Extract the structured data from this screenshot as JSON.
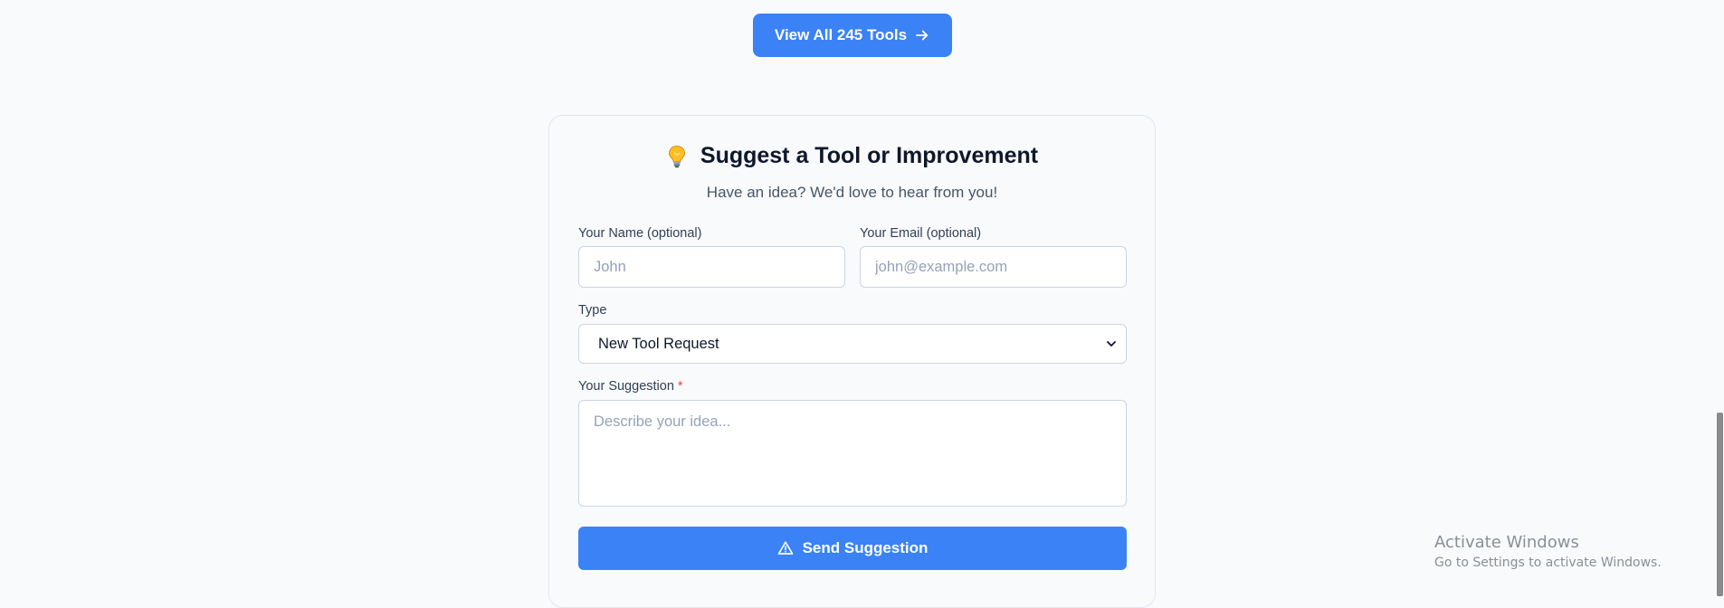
{
  "view_all_button": {
    "label": "View All 245 Tools",
    "icon": "arrow-right-icon"
  },
  "suggest_card": {
    "title": "Suggest a Tool or Improvement",
    "title_icon": "lightbulb-icon",
    "subtitle": "Have an idea? We'd love to hear from you!",
    "name_field": {
      "label": "Your Name (optional)",
      "value": "",
      "placeholder": "John"
    },
    "email_field": {
      "label": "Your Email (optional)",
      "value": "",
      "placeholder": "john@example.com"
    },
    "type_field": {
      "label": "Type",
      "selected": "New Tool Request"
    },
    "suggestion_field": {
      "label": "Your Suggestion",
      "required_marker": "*",
      "value": "",
      "placeholder": "Describe your idea..."
    },
    "send_button": {
      "label": "Send Suggestion",
      "icon": "warning-triangle-icon"
    }
  },
  "windows_watermark": {
    "title": "Activate Windows",
    "subtitle": "Go to Settings to activate Windows."
  },
  "colors": {
    "accent": "#3b82f6",
    "background": "#f8fafc",
    "border": "#cbd5e1",
    "required": "#ef4444"
  }
}
